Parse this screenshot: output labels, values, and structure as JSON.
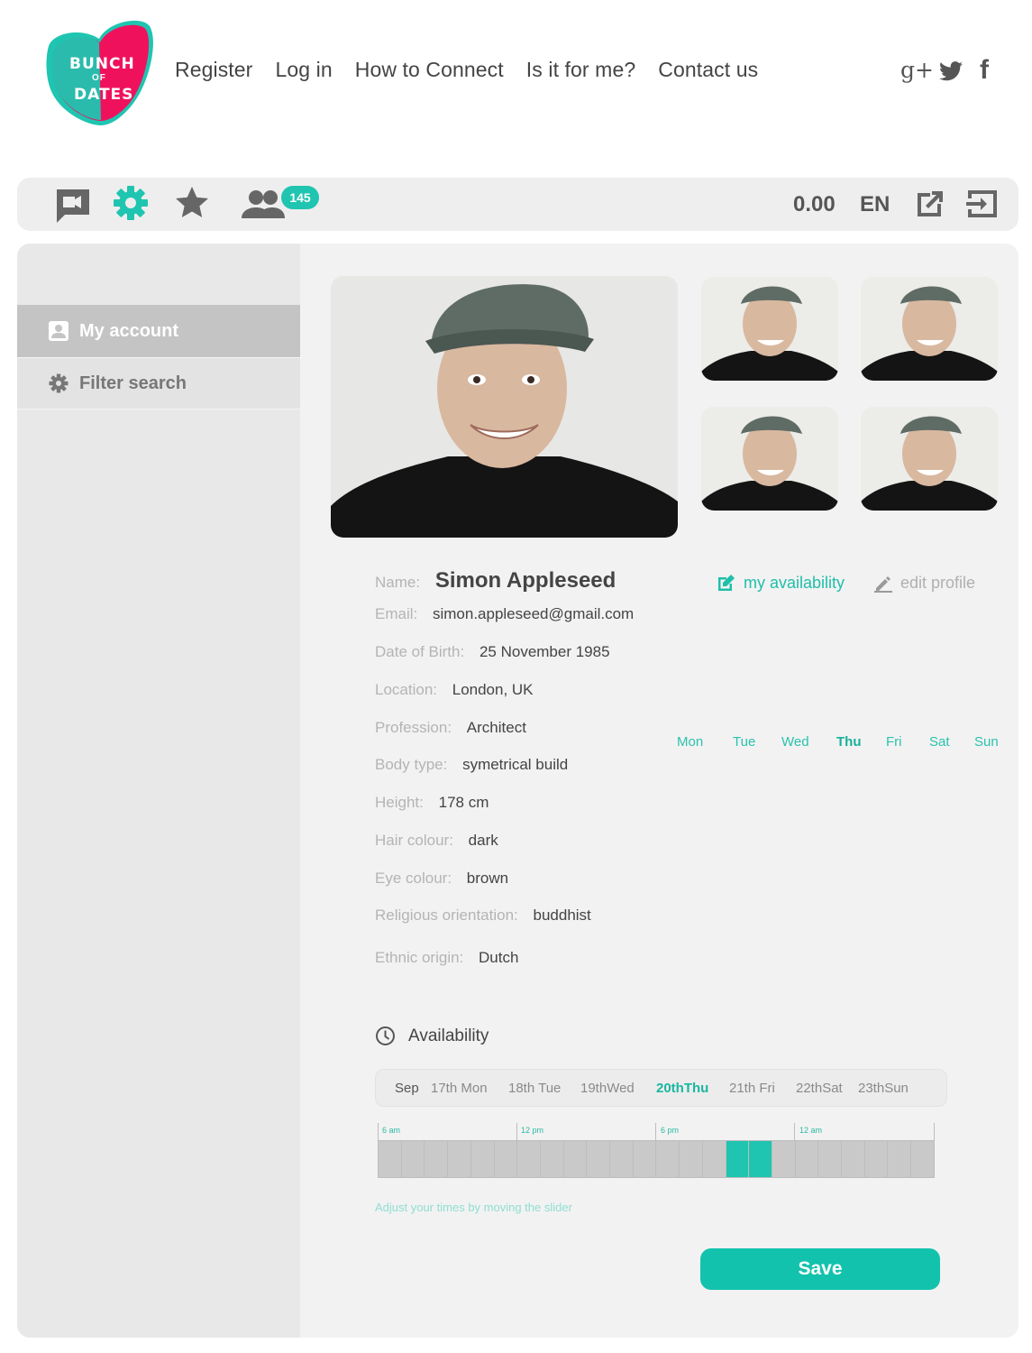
{
  "brand": {
    "logo_text_top": "BUNCH",
    "logo_text_mid": "OF",
    "logo_text_bottom": "DATES",
    "color_accent": "#1fc5b0",
    "color_logo_heart": "#f0115d"
  },
  "nav": {
    "items": [
      "Register",
      "Log in",
      "How to Connect",
      "Is it for me?",
      "Contact us"
    ]
  },
  "social": {
    "icons": [
      "google-plus-icon",
      "twitter-icon",
      "facebook-icon"
    ],
    "google_plus_glyph": "g+",
    "facebook_glyph": "f"
  },
  "toolbar": {
    "icons": [
      "video-chat-icon",
      "settings-icon",
      "star-icon",
      "users-icon",
      "external-link-icon",
      "logout-icon"
    ],
    "users_badge": "145",
    "balance": "0.00",
    "language": "EN"
  },
  "sidebar": {
    "items": [
      {
        "label": "My account",
        "icon": "account-icon",
        "active": true
      },
      {
        "label": "Filter search",
        "icon": "gear-icon",
        "active": false
      }
    ]
  },
  "profile": {
    "name_label": "Name:",
    "name": "Simon Appleseed",
    "fields": [
      {
        "label": "Email:",
        "value": "simon.appleseed@gmail.com"
      },
      {
        "label": "Date of Birth:",
        "value": "25 November 1985"
      },
      {
        "label": "Location:",
        "value": "London, UK"
      },
      {
        "label": "Profession:",
        "value": "Architect"
      },
      {
        "label": "Body type:",
        "value": "symetrical build"
      },
      {
        "label": "Height:",
        "value": "178 cm"
      },
      {
        "label": "Hair colour:",
        "value": "dark"
      },
      {
        "label": "Eye colour:",
        "value": "brown"
      },
      {
        "label": "Religious orientation:",
        "value": "buddhist"
      },
      {
        "label": "Ethnic origin:",
        "value": "Dutch"
      }
    ],
    "my_availability_link": "my availability",
    "edit_profile_link": "edit profile"
  },
  "weekdays": {
    "days": [
      "Mon",
      "Tue",
      "Wed",
      "Thu",
      "Fri",
      "Sat",
      "Sun"
    ],
    "current": "Thu"
  },
  "availability": {
    "title": "Availability",
    "month": "Sep",
    "dates": [
      "17th Mon",
      "18th Tue",
      "19thWed",
      "20thThu",
      "21th Fri",
      "22thSat",
      "23thSun"
    ],
    "current_date": "20thThu",
    "time_labels": [
      "6 am",
      "12 pm",
      "6 pm",
      "12 am"
    ],
    "slot_count": 24,
    "selected_slots": [
      15,
      16
    ],
    "hint": "Adjust your times by moving the slider",
    "save_label": "Save"
  }
}
